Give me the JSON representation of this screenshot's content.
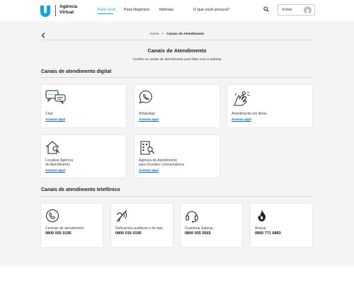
{
  "header": {
    "brand_line1": "Agência",
    "brand_line2": "Virtual",
    "nav": [
      {
        "label": "Para Você"
      },
      {
        "label": "Para Negócios"
      },
      {
        "label": "Notícias"
      }
    ],
    "search_placeholder": "O que você procura?",
    "login_label": "Entrar",
    "accent_color": "#1aa3d9"
  },
  "breadcrumb": {
    "home": "Home",
    "separator": ">",
    "current": "Canais de Atendimento"
  },
  "page": {
    "title": "Canais de Atendimento",
    "subtitle": "Confira os canais de atendimento para falar com a Sabesp"
  },
  "digital": {
    "section_title": "Canais de atendimento digital",
    "cards": [
      {
        "icon": "chat-icon",
        "label": "Chat",
        "link": "Acesse aqui"
      },
      {
        "icon": "whatsapp-icon",
        "label": "WhatsApp",
        "link": "Acesse aqui"
      },
      {
        "icon": "sign-language-icon",
        "label": "Atendimento em libras",
        "link": "Acesse aqui"
      },
      {
        "icon": "house-search-icon",
        "label_line1": "Localizar Agência",
        "label_line2": "de Atendimento",
        "link": "Acesse aqui"
      },
      {
        "icon": "building-search-icon",
        "label_line1": "Agência de Atendimento",
        "label_line2": "para Grandes Consumidores",
        "link": "Acesse aqui"
      }
    ]
  },
  "phone": {
    "section_title": "Canais de atendimento telefônico",
    "cards": [
      {
        "icon": "phone-icon",
        "label": "Centrais de atendimento",
        "number": "0800 055 0195"
      },
      {
        "icon": "ear-icon",
        "label": "Deficientes auditivos e de fala",
        "number": "0800 016 0195"
      },
      {
        "icon": "headset-icon",
        "label": "Ouvidoria Sabesp",
        "number": "0800 055 0565"
      },
      {
        "icon": "flame-icon",
        "label": "Arsesp",
        "number": "0800 771 6883"
      }
    ]
  }
}
